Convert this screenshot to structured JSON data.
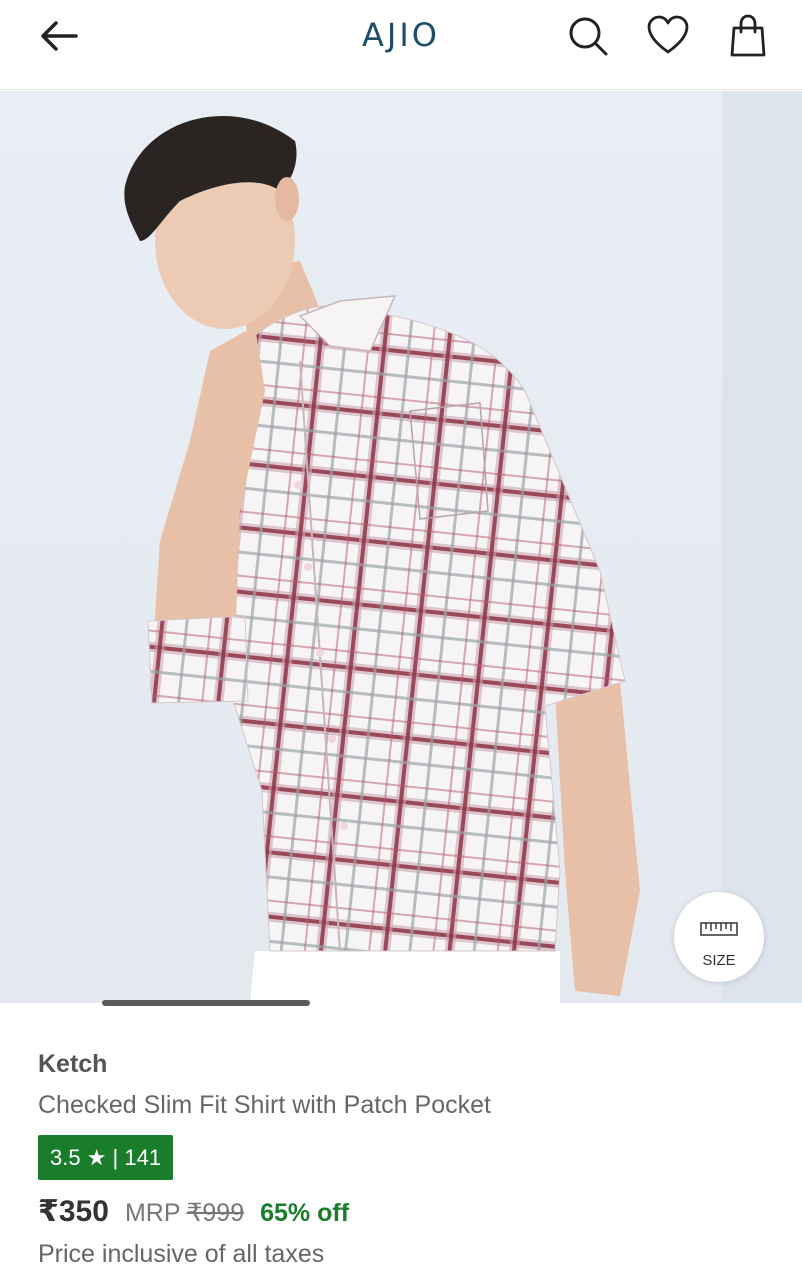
{
  "header": {
    "logo": "AJIO",
    "icons": {
      "back": "arrow-left-icon",
      "search": "search-icon",
      "wishlist": "heart-icon",
      "bag": "shopping-bag-icon"
    }
  },
  "gallery": {
    "image": "man wearing checked slim fit shirt",
    "size_label": "SIZE",
    "size_icon": "ruler-icon"
  },
  "product": {
    "brand": "Ketch",
    "title": "Checked Slim Fit Shirt with Patch Pocket",
    "rating": "3.5 ★ | 141",
    "price": "₹350",
    "mrp_label": "MRP",
    "mrp_value": "₹999",
    "discount": "65% off",
    "tax_note": "Price inclusive of all taxes"
  },
  "colors": {
    "brand_blue": "#1e4d6b",
    "rating_green": "#1a7d2b",
    "discount_green": "#1a7d2b"
  }
}
